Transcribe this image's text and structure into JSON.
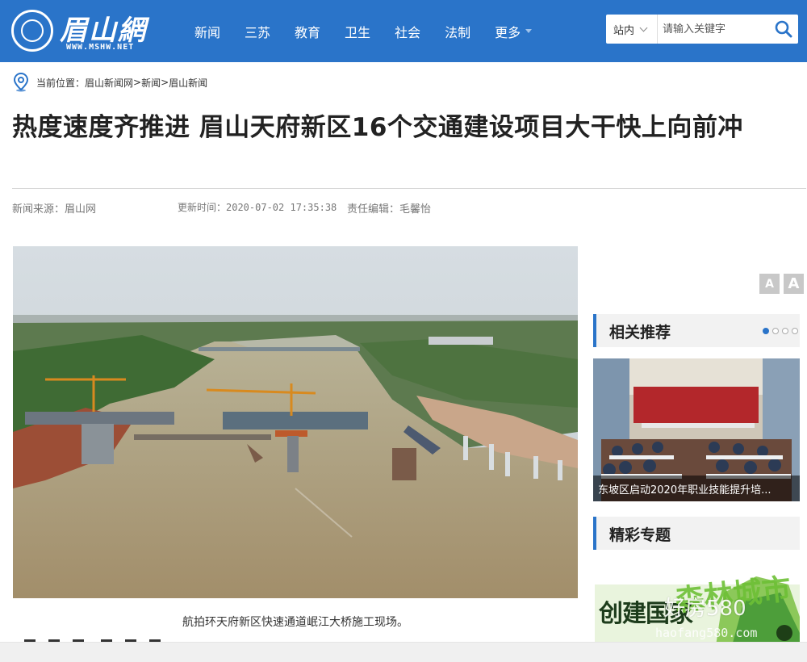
{
  "site": {
    "logo_text": "眉山網",
    "logo_url": "WWW.MSHW.NET"
  },
  "nav": {
    "items": [
      "新闻",
      "三苏",
      "教育",
      "卫生",
      "社会",
      "法制"
    ],
    "more_label": "更多"
  },
  "search": {
    "scope": "站内",
    "placeholder": "请输入关键字"
  },
  "breadcrumb": {
    "prefix": "当前位置：",
    "items": [
      "眉山新闻网",
      "新闻",
      "眉山新闻"
    ],
    "separator": ">"
  },
  "article": {
    "title": "热度速度齐推进 眉山天府新区16个交通建设项目大干快上向前冲",
    "source": "新闻来源：眉山网",
    "updated": "更新时间：2020-07-02 17:35:38",
    "editor": "责任编辑：毛馨怡",
    "caption": "航拍环天府新区快速通道岷江大桥施工现场。"
  },
  "font_controls": {
    "decrease": "A",
    "increase": "A"
  },
  "sidebar": {
    "recommend_title": "相关推荐",
    "recommend_caption": "东坡区启动2020年职业技能提升培...",
    "topics_title": "精彩专题",
    "topic_banner_text": "创建国家",
    "topic_banner_text2": "森林城市"
  },
  "watermark": {
    "line1": "好房580",
    "line2": "haofang580.com"
  },
  "colors": {
    "brand": "#2a74c9",
    "accent_dot": "#2a74c9"
  }
}
